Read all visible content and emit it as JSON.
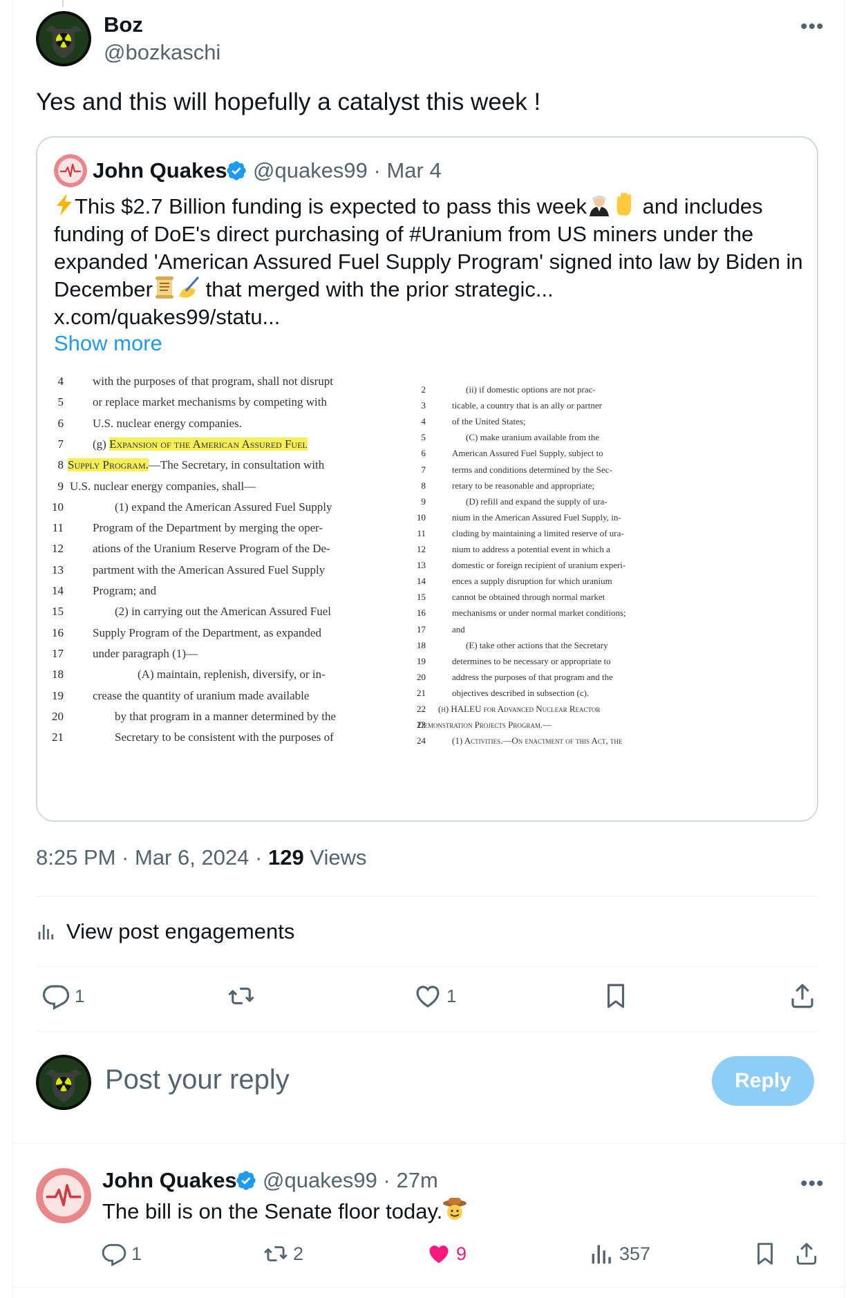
{
  "post": {
    "author_name": "Boz",
    "author_handle": "@bozkaschi",
    "text": "Yes and this will hopefully a catalyst this week !",
    "timestamp": "8:25 PM · Mar 6, 2024 · ",
    "views_count": "129",
    "views_label": " Views",
    "engagements_label": "View post engagements",
    "actions": {
      "reply_count": "1",
      "like_count": "1"
    }
  },
  "quote": {
    "author_name": "John Quakes",
    "meta": "@quakes99 · Mar 4",
    "lines": [
      "This $2.7 Billion funding is expected to pass this week",
      " and includes",
      "funding of DoE's direct purchasing of #Uranium from US miners under the",
      "expanded 'American Assured Fuel Supply Program' signed into law by Biden in",
      "December",
      " that merged with the prior strategic...",
      "x.com/quakes99/statu..."
    ],
    "show_more": "Show more",
    "document": {
      "left": [
        {
          "n": "4",
          "t": "with the purposes of that program, shall not disrupt"
        },
        {
          "n": "5",
          "t": "or replace market mechanisms by competing with"
        },
        {
          "n": "6",
          "t": "U.S. nuclear energy companies."
        },
        {
          "n": "7",
          "t_pre": "(g) ",
          "t_hl": "Expansion of the American Assured Fuel"
        },
        {
          "n": "8",
          "t_hl": "Supply Program.",
          "t_post": "—The Secretary, in consultation with"
        },
        {
          "n": "9",
          "t": "U.S. nuclear energy companies, shall—"
        },
        {
          "n": "10",
          "t": "(1) expand the American Assured Fuel Supply"
        },
        {
          "n": "11",
          "t": "Program of the Department by merging the oper-"
        },
        {
          "n": "12",
          "t": "ations of the Uranium Reserve Program of the De-"
        },
        {
          "n": "13",
          "t": "partment with the American Assured Fuel Supply"
        },
        {
          "n": "14",
          "t": "Program; and"
        },
        {
          "n": "15",
          "t": "(2) in carrying out the American Assured Fuel"
        },
        {
          "n": "16",
          "t": "Supply Program of the Department, as expanded"
        },
        {
          "n": "17",
          "t": "under paragraph (1)—"
        },
        {
          "n": "18",
          "t": "(A) maintain, replenish, diversify, or in-"
        },
        {
          "n": "19",
          "t": "crease the quantity of uranium made available"
        },
        {
          "n": "20",
          "t": "by that program in a manner determined by the"
        },
        {
          "n": "21",
          "t": "Secretary to be consistent with the purposes of"
        }
      ],
      "right": [
        {
          "n": "2",
          "t": "(ii) if domestic options are not prac-"
        },
        {
          "n": "3",
          "t": "ticable, a country that is an ally or partner"
        },
        {
          "n": "4",
          "t": "of the United States;"
        },
        {
          "n": "5",
          "t": "(C) make uranium available from the"
        },
        {
          "n": "6",
          "t": "American Assured Fuel Supply, subject to"
        },
        {
          "n": "7",
          "t": "terms and conditions determined by the Sec-"
        },
        {
          "n": "8",
          "t": "retary to be reasonable and appropriate;"
        },
        {
          "n": "9",
          "t": "(D) refill and expand the supply of ura-"
        },
        {
          "n": "10",
          "t": "nium in the American Assured Fuel Supply, in-"
        },
        {
          "n": "11",
          "t": "cluding by maintaining a limited reserve of ura-"
        },
        {
          "n": "12",
          "t": "nium to address a potential event in which a"
        },
        {
          "n": "13",
          "t": "domestic or foreign recipient of uranium experi-"
        },
        {
          "n": "14",
          "t": "ences a supply disruption for which uranium"
        },
        {
          "n": "15",
          "t": "cannot be obtained through normal market"
        },
        {
          "n": "16",
          "t": "mechanisms or under normal market conditions;"
        },
        {
          "n": "17",
          "t": "and"
        },
        {
          "n": "18",
          "t": "(E) take other actions that the Secretary"
        },
        {
          "n": "19",
          "t": "determines to be necessary or appropriate to"
        },
        {
          "n": "20",
          "t": "address the purposes of that program and the"
        },
        {
          "n": "21",
          "t": "objectives described in subsection (c)."
        },
        {
          "n": "22",
          "t": "(h) HALEU for Advanced Nuclear Reactor"
        },
        {
          "n": "23",
          "t": "Demonstration Projects Program.—"
        },
        {
          "n": "24",
          "t": "(1) Activities.—On enactment of this Act, the"
        }
      ]
    }
  },
  "composer": {
    "placeholder": "Post your reply",
    "button_label": "Reply"
  },
  "reply": {
    "author_name": "John Quakes",
    "meta": "@quakes99 · 27m",
    "text": "The bill is on the Senate floor today.",
    "actions": {
      "reply_count": "1",
      "repost_count": "2",
      "like_count": "9",
      "views_count": "357"
    }
  },
  "colors": {
    "accent": "#1d9bf0",
    "like_pink": "#f91880",
    "highlight": "#f6f056",
    "secondary_text": "#536471"
  },
  "icons": [
    "verified-badge-icon",
    "reply-icon",
    "repost-icon",
    "like-icon",
    "bookmark-icon",
    "share-icon",
    "analytics-icon",
    "more-icon",
    "lightning-emoji",
    "scroll-emoji",
    "writing-hand-emoji",
    "cowboy-emoji"
  ]
}
